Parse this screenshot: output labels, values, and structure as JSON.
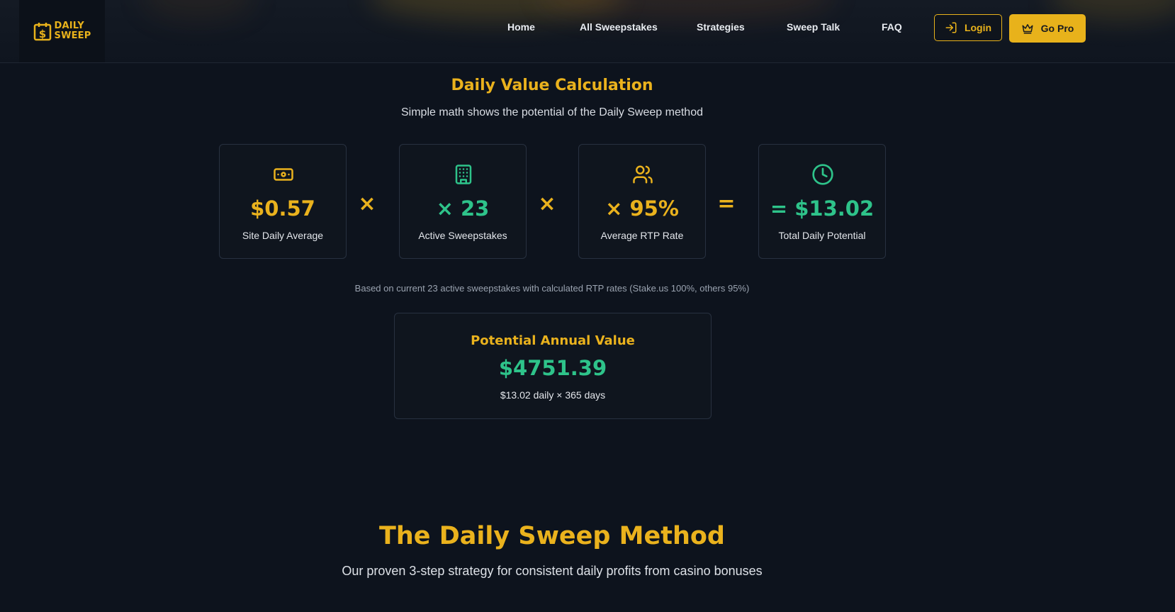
{
  "brand": {
    "logo_line1": "DAILY",
    "logo_line2": "SWEEP",
    "logo_icon": "calendar-dollar-icon",
    "accent_color": "#eab21d",
    "positive_color": "#2ec38a"
  },
  "nav": {
    "items": [
      {
        "label": "Home"
      },
      {
        "label": "All Sweepstakes"
      },
      {
        "label": "Strategies"
      },
      {
        "label": "Sweep Talk"
      },
      {
        "label": "FAQ"
      }
    ],
    "login_label": "Login",
    "login_icon": "sign-in-icon",
    "pro_label": "Go Pro",
    "pro_icon": "crown-icon"
  },
  "calculation": {
    "title": "Daily Value Calculation",
    "subtitle": "Simple math shows the potential of the Daily Sweep method",
    "cards": [
      {
        "icon": "banknote-icon",
        "value": "$0.57",
        "label": "Site Daily Average",
        "color": "#eab21d"
      },
      {
        "icon": "building-icon",
        "value": "× 23",
        "label": "Active Sweepstakes",
        "color": "#2ec38a"
      },
      {
        "icon": "users-icon",
        "value": "× 95%",
        "label": "Average RTP Rate",
        "color": "#eab21d"
      },
      {
        "icon": "clock-icon",
        "value": "= $13.02",
        "label": "Total Daily Potential",
        "color": "#2ec38a"
      }
    ],
    "operators": [
      "×",
      "×",
      "="
    ],
    "basis_note": "Based on current 23 active sweepstakes with calculated RTP rates (Stake.us 100%, others 95%)"
  },
  "annual": {
    "title": "Potential Annual Value",
    "value": "$4751.39",
    "formula": "$13.02 daily × 365 days"
  },
  "method": {
    "title": "The Daily Sweep Method",
    "subtitle": "Our proven 3-step strategy for consistent daily profits from casino bonuses"
  }
}
